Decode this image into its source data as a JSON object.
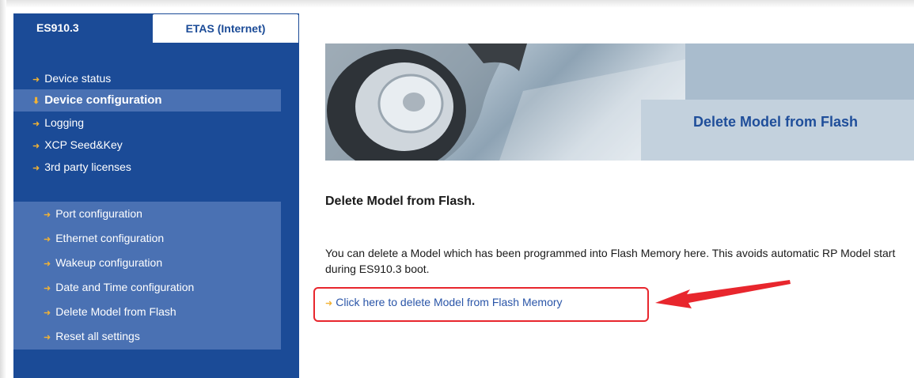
{
  "tabs": [
    {
      "label": "ES910.3",
      "selected": true
    },
    {
      "label": "ETAS (Internet)",
      "selected": false
    }
  ],
  "menu": [
    {
      "label": "Device status",
      "active": false
    },
    {
      "label": "Device configuration",
      "active": true
    },
    {
      "label": "Logging",
      "active": false
    },
    {
      "label": "XCP Seed&Key",
      "active": false
    },
    {
      "label": "3rd party licenses",
      "active": false
    }
  ],
  "submenu": [
    {
      "label": "Port configuration"
    },
    {
      "label": "Ethernet configuration"
    },
    {
      "label": "Wakeup configuration"
    },
    {
      "label": "Date and Time configuration"
    },
    {
      "label": "Delete Model from Flash"
    },
    {
      "label": "Reset all settings"
    }
  ],
  "banner": {
    "title": "Delete Model from Flash"
  },
  "content": {
    "heading": "Delete Model from Flash.",
    "description": "You can delete a Model which has been programmed into Flash Memory here. This avoids automatic RP Model start during ES910.3 boot.",
    "link_label": "Click here to delete Model from Flash Memory"
  },
  "icons": {
    "menu_arrow": "arrow-right-icon"
  },
  "colors": {
    "sidebar": "#1b4b97",
    "submenu": "#4a71b3",
    "arrow": "#f2b233",
    "link": "#2a55a8",
    "annotation": "#e8262d"
  }
}
